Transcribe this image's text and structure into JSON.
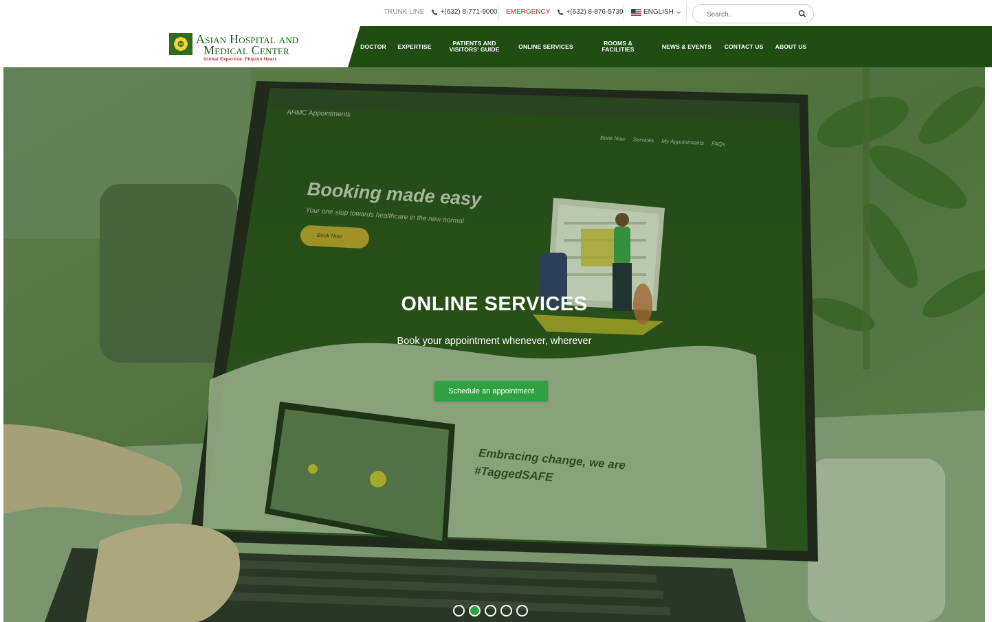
{
  "topbar": {
    "trunk_label": "TRUNK LINE",
    "trunk_phone": "+(632) 8-771-9000",
    "emergency_label": "EMERGENCY",
    "emergency_phone": "+(632) 8-876-5739",
    "language": "ENGLISH",
    "search_placeholder": "Search.."
  },
  "brand": {
    "line1": "Asian Hospital and",
    "line2": "Medical Center",
    "tagline": "Global Expertise. Filipino Heart."
  },
  "nav": {
    "items": [
      {
        "label": "DOCTOR"
      },
      {
        "label": "EXPERTISE"
      },
      {
        "label": "PATIENTS AND VISITORS' GUIDE"
      },
      {
        "label": "ONLINE SERVICES"
      },
      {
        "label": "ROOMS & FACILITIES"
      },
      {
        "label": "NEWS & EVENTS"
      },
      {
        "label": "CONTACT US"
      },
      {
        "label": "ABOUT US"
      }
    ]
  },
  "hero": {
    "title": "ONLINE SERVICES",
    "subtitle": "Book your appointment whenever, wherever",
    "cta_label": "Schedule an appointment",
    "screen": {
      "app_name": "AHMC Appointments",
      "nav": [
        "Book Now",
        "Services",
        "My Appointments",
        "FAQs"
      ],
      "headline": "Booking made easy",
      "tagline": "Your one stop towards healthcare in the new normal",
      "book_button": "Book Now",
      "section_heading_1": "Embracing change, we are",
      "section_heading_2": "#TaggedSAFE"
    },
    "slides_total": 5,
    "active_slide": 2
  },
  "colors": {
    "nav_green": "#1f4d12",
    "accent_green": "#2ea243",
    "brand_red": "#c0262d"
  }
}
